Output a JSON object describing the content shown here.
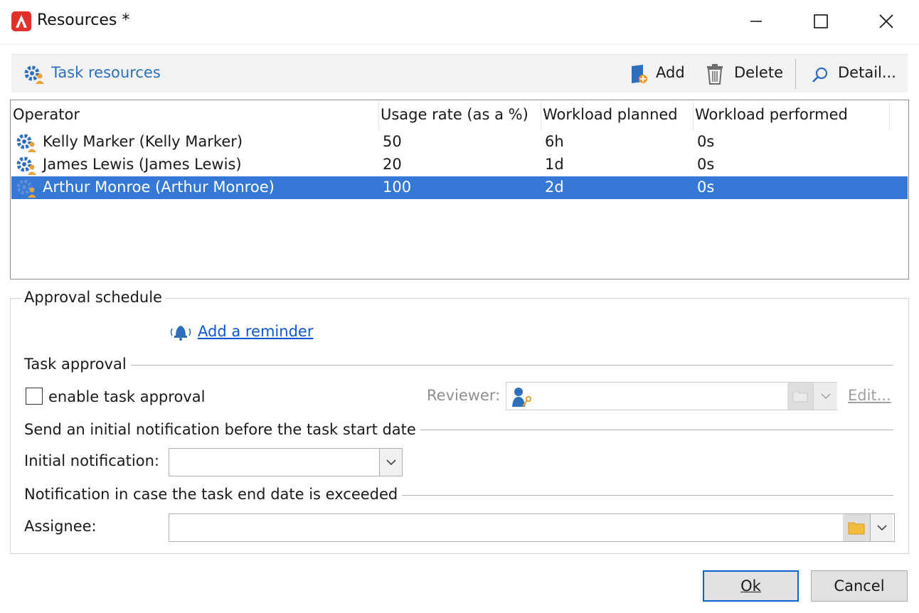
{
  "window": {
    "title": "Resources *",
    "minimize_glyph": "—",
    "maximize_glyph": "☐",
    "close_glyph": "✕",
    "app_icon_letter": "A"
  },
  "toolbar": {
    "title": "Task resources",
    "add_label": "Add",
    "delete_label": "Delete",
    "detail_label": "Detail..."
  },
  "list": {
    "columns": [
      "Operator",
      "Usage rate (as a %)",
      "Workload planned",
      "Workload performed"
    ],
    "rows": [
      {
        "operator": "Kelly Marker (Kelly Marker)",
        "usage": "50",
        "planned": "6h",
        "performed": "0s",
        "selected": false
      },
      {
        "operator": "James Lewis (James Lewis)",
        "usage": "20",
        "planned": "1d",
        "performed": "0s",
        "selected": false
      },
      {
        "operator": "Arthur Monroe (Arthur Monroe)",
        "usage": "100",
        "planned": "2d",
        "performed": "0s",
        "selected": true
      }
    ]
  },
  "approval": {
    "group_title": "Approval schedule",
    "add_reminder": "Add a reminder",
    "task_approval_title": "Task approval",
    "enable_label": "enable task approval",
    "enable_checked": false,
    "reviewer_label": "Reviewer:",
    "reviewer_value": "",
    "edit_link": "Edit...",
    "initial_section_title": "Send an initial notification before the task start date",
    "initial_label": "Initial notification:",
    "initial_value": "",
    "exceeded_section_title": "Notification in case the task end date is exceeded",
    "assignee_label": "Assignee:",
    "assignee_value": ""
  },
  "buttons": {
    "ok": "Ok",
    "cancel": "Cancel"
  },
  "colors": {
    "selection": "#3578d6",
    "link": "#0b57d0",
    "toolbar_title": "#2d6fbd",
    "app_icon": "#e2302b"
  }
}
